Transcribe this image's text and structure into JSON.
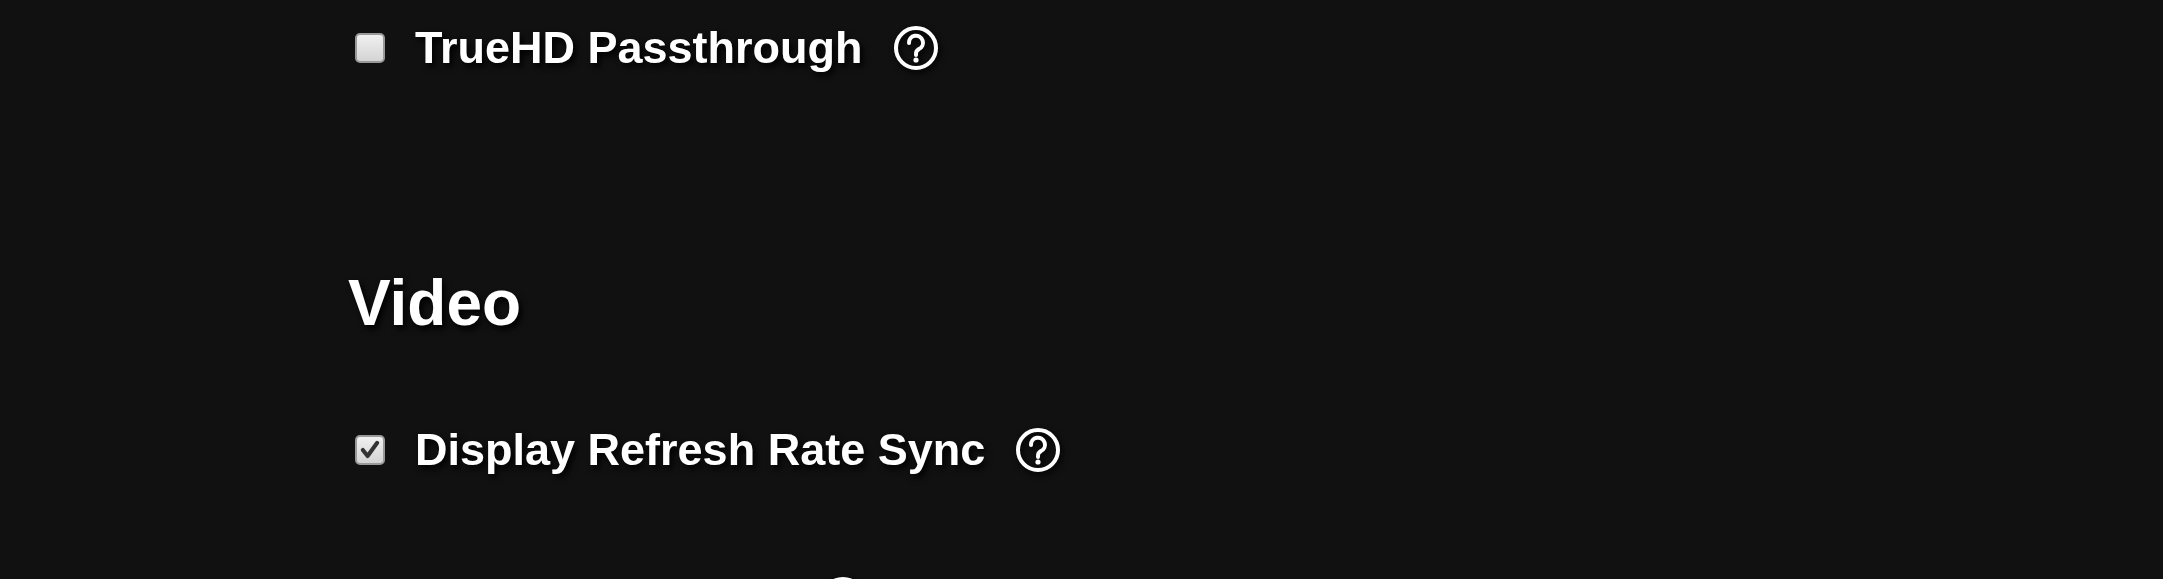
{
  "sections": [
    {
      "kind": "options",
      "options": [
        {
          "label": "TrueHD Passthrough",
          "checked": false,
          "help": true
        }
      ]
    },
    {
      "kind": "heading",
      "title": "Video"
    },
    {
      "kind": "options",
      "options": [
        {
          "label": "Display Refresh Rate Sync",
          "checked": true,
          "help": true
        }
      ]
    }
  ]
}
